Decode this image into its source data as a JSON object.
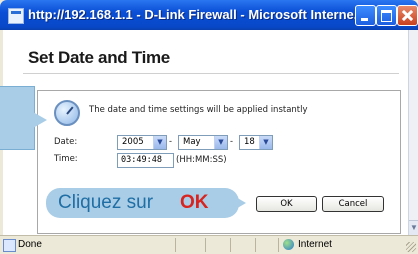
{
  "window": {
    "title": "http://192.168.1.1 - D-Link Firewall - Microsoft Interne...",
    "minimize_label": "",
    "maximize_label": "",
    "close_label": ""
  },
  "page": {
    "title": "Set Date and Time",
    "message": "The date and time settings will be applied instantly"
  },
  "form": {
    "date_label": "Date:",
    "year": "2005",
    "month": "May",
    "day": "18",
    "separator": "-",
    "time_label": "Time:",
    "time_value": "03:49:48",
    "time_hint": "(HH:MM:SS)",
    "ok_label": "OK",
    "cancel_label": "Cancel"
  },
  "annotation": {
    "click_text": "Cliquez sur",
    "click_ok": "OK"
  },
  "statusbar": {
    "status": "Done",
    "zone": "Internet"
  },
  "colors": {
    "titlebar": "#0a4fd6",
    "callout": "#a9cde6",
    "callout_text": "#1f6ea5",
    "ok_highlight": "#d8231f"
  }
}
